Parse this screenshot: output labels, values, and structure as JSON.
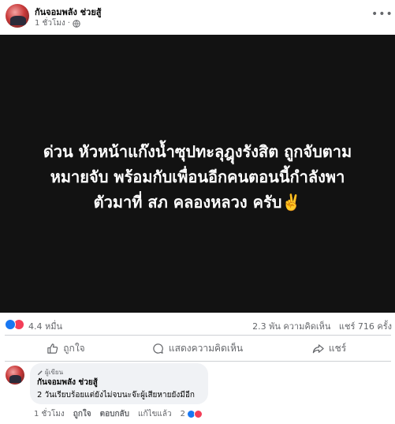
{
  "post": {
    "author": "กันจอมพลัง ช่วยสู้",
    "time": "1 ชั่วโมง",
    "privacy_icon": "globe-icon",
    "media_text_lines": [
      "ด่วน หัวหน้าแก๊งน้ำซุปทะลุฎุงรังสิต ถูกจับตาม",
      "หมายจับ พร้อมกับเพื่อนอีกคนตอนนี้กำลังพา",
      "ตัวมาที่ สภ คลองหลวง ครับ✌️"
    ]
  },
  "stats": {
    "reactions": "4.4 หมื่น",
    "comments": "2.3 พัน ความคิดเห็น",
    "shares": "แชร์ 716 ครั้ง"
  },
  "actions": {
    "like": "ถูกใจ",
    "comment": "แสดงความคิดเห็น",
    "share": "แชร์"
  },
  "comment": {
    "badge": "ผู้เขียน",
    "author": "กันจอมพลัง ช่วยสู้",
    "text": "2 วันเรียบร้อยแต่ยังไม่จบนะจ๊ะผู้เสียหายยังมีอีก",
    "time": "1 ชั่วโมง",
    "like": "ถูกใจ",
    "reply": "ตอบกลับ",
    "edited": "แก้ไขแล้ว",
    "reaction_count": "2"
  },
  "colors": {
    "like": "#1877f2",
    "love": "#f33e58",
    "media_bg": "#121212",
    "muted": "#65676b"
  }
}
